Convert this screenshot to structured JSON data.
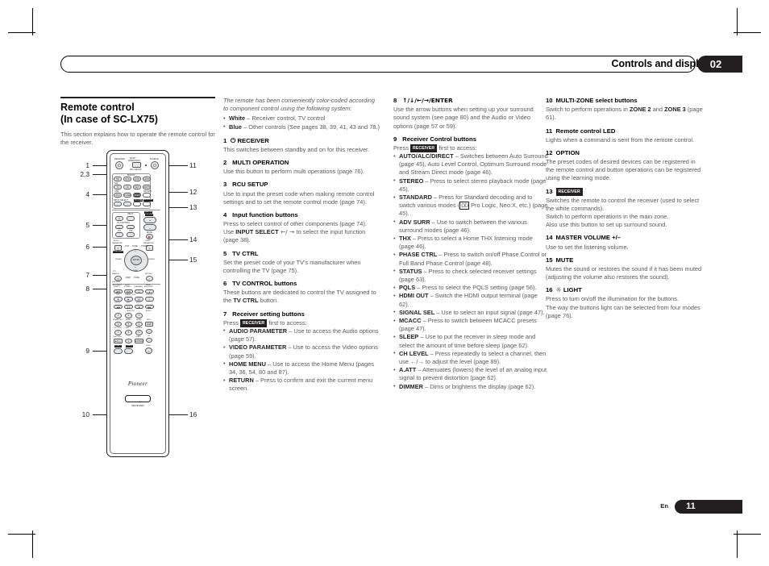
{
  "header": {
    "title": "Controls and displays",
    "chapter_number": "02"
  },
  "footer": {
    "language": "En",
    "page_number": "11"
  },
  "column1": {
    "section_title_line1": "Remote control",
    "section_title_line2": "(In case of SC-LX75)",
    "section_intro": "This section explains how to operate the remote control for the receiver.",
    "callouts": [
      "1",
      "2,3",
      "4",
      "5",
      "6",
      "7",
      "8",
      "9",
      "10",
      "11",
      "12",
      "13",
      "14",
      "15",
      "16"
    ],
    "remote": {
      "brand": "Pioneer",
      "model_chip": "RECEIVER",
      "top_labels": {
        "receiver": "RECEIVER",
        "multi_operation": "MULTI OPERATION",
        "source": "SOURCE",
        "rcu_setup": "RCU SETUP"
      },
      "input_rows": [
        {
          "group_left": "",
          "group_mid": "BD/DVD",
          "buttons": [
            "BD",
            "DVD",
            "DVR",
            "HDMI"
          ]
        },
        {
          "group_left": "SAT",
          "group_mid": "",
          "buttons": [
            "TV",
            "CD",
            "NET",
            "ADPT"
          ]
        },
        {
          "group_left": "USB",
          "group_mid": "",
          "buttons": [
            "iPod",
            "TUNER",
            "VIDEO"
          ]
        }
      ],
      "input_select": "INPUT SELECT",
      "tv_ctrl": "TV CTRL",
      "option": "OPTION",
      "receiver_btn": "RECEIVER",
      "tv_control": "TV CONTROL",
      "tv_input": "INPUT",
      "master_volume": "MASTER VOLUME",
      "mute": "MUTE",
      "ch": "CH",
      "vol": "VOL",
      "audio_parameter": "AUDIO PARAMETER",
      "video_parameter": "VIDEO PARAMETER",
      "home_menu": "HOME MENU",
      "list": "LIST",
      "tune": "TUNE",
      "tools": "TOOLS",
      "enter": "ENTER",
      "preset": "PRESET",
      "return": "RETURN",
      "pty_search": "PTY SEARCH",
      "disp": "DISP",
      "listening_rows": [
        [
          "AUTO/ALC/DIRECT",
          "STEREO",
          "STANDARD",
          "ADV SURR"
        ],
        [
          "THX",
          "PHASE CTRL",
          "STATUS"
        ],
        [
          "TV/DTV",
          "MPX",
          "PQLS"
        ]
      ],
      "numpad": [
        "1",
        "2",
        "3",
        "4",
        "5",
        "6",
        "7",
        "8",
        "9",
        "0"
      ],
      "numpad_labels": [
        "HDMI OUT",
        "SIGNAL SEL",
        "MCACC",
        "SLEEP",
        "CH LEVEL",
        "A.ATT",
        "DIMMER",
        "CLASS",
        "D.ACCESS"
      ],
      "side_labels": [
        "AUDIO",
        "INFO",
        "DISP",
        "CH"
      ],
      "zones": [
        "ZONE 2",
        "ZONE 3"
      ],
      "light": "LIGHT"
    }
  },
  "column2": {
    "intro_italic": "The remote has been conveniently color-coded according to component control using the following system:",
    "color_bullets": [
      {
        "bold": "White",
        "text": " – Receiver control, TV control"
      },
      {
        "bold": "Blue",
        "text": " – Other controls (See pages 38, 39, 41, 43 and 78.)"
      }
    ],
    "entries": [
      {
        "num": "1",
        "title": "RECEIVER",
        "title_prefix_icon": "power-icon",
        "body": "This switches between standby and on for this receiver."
      },
      {
        "num": "2",
        "title": "MULTI OPERATION",
        "body": "Use this button to perform multi operations (page 76)."
      },
      {
        "num": "3",
        "title": "RCU SETUP",
        "body": "Use to input the preset code when making remote control settings and to set the remote control mode (page 74)."
      },
      {
        "num": "4",
        "title": "Input function buttons",
        "body": "Press to select control of other components (page 74).",
        "body2_pre": "Use ",
        "body2_bold": "INPUT SELECT",
        "body2_arrows": " ←/ → ",
        "body2_post": "to select the input function (page 38)."
      },
      {
        "num": "5",
        "title": "TV CTRL",
        "body": "Set the preset code of your TV's manufacturer when controlling the TV (page 75)."
      },
      {
        "num": "6",
        "title": "TV CONTROL buttons",
        "body_pre": "These buttons are dedicated to control the TV assigned to the ",
        "body_bold": "TV CTRL",
        "body_post": " button."
      },
      {
        "num": "7",
        "title": "Receiver setting buttons",
        "body_pre": "Press ",
        "chip": "RECEIVER",
        "body_post": " first to access:",
        "bullets": [
          {
            "bold": "AUDIO PARAMETER",
            "text": " – Use to access the Audio options (page 57)."
          },
          {
            "bold": "VIDEO PARAMETER",
            "text": " – Use to access the Video options (page 59)."
          },
          {
            "bold": "HOME MENU",
            "text": " – Use to access the Home Menu (pages 34, 36, 54, 80 and 87)."
          },
          {
            "bold": "RETURN",
            "text": " – Press to confirm and exit the current menu screen."
          }
        ]
      }
    ]
  },
  "column3": {
    "entries": [
      {
        "num": "8",
        "title": "↑/↓/←/→/ENTER",
        "body": "Use the arrow buttons when setting up your surround sound system (see page 80) and the Audio or Video options (page 57 or 59)."
      },
      {
        "num": "9",
        "title": "Receiver Control buttons",
        "body_pre": "Press ",
        "chip": "RECEIVER",
        "body_post": " first to access:",
        "bullets": [
          {
            "bold": "AUTO/ALC/DIRECT",
            "text": " – Switches between Auto Surround (page 45), Auto Level Control, Optimum Surround mode and Stream Direct mode (page 46)."
          },
          {
            "bold": "STEREO",
            "text": " – Press to select stereo playback mode (page 45)."
          },
          {
            "bold": "STANDARD",
            "text": " – Press for Standard decoding and to switch various modes (",
            "dd": "DD",
            "text2": " Pro Logic, Neo:X, etc.) (page 45)."
          },
          {
            "bold": "ADV SURR",
            "text": " – Use to switch between the various surround modes (page 46)."
          },
          {
            "bold": "THX",
            "text": " – Press to select a Home THX listening mode (page 46)."
          },
          {
            "bold": "PHASE CTRL",
            "text": " – Press to switch on/off Phase Control or Full Band Phase Control (page 48)."
          },
          {
            "bold": "STATUS",
            "text": " – Press to check selected receiver settings (page 63)."
          },
          {
            "bold": "PQLS",
            "text": " – Press to select the PQLS setting (page 56)."
          },
          {
            "bold": "HDMI OUT",
            "text": " – Switch the HDMI output terminal (page 62)."
          },
          {
            "bold": "SIGNAL SEL",
            "text": " – Use to select an input signal (page 47)."
          },
          {
            "bold": "MCACC",
            "text": " – Press to switch between MCACC presets (page 47)."
          },
          {
            "bold": "SLEEP",
            "text": " – Use to put the receiver in sleep mode and select the amount of time before sleep (page 62)."
          },
          {
            "bold": "CH LEVEL",
            "text": " – Press repeatedly to select a channel, then use ←/→ to adjust the level (page 89)."
          },
          {
            "bold": "A.ATT",
            "text": " – Attenuates (lowers) the level of an analog input signal to prevent distortion (page 62)."
          },
          {
            "bold": "DIMMER",
            "text": " – Dims or brightens the display (page 62)."
          }
        ]
      }
    ]
  },
  "column4": {
    "entries": [
      {
        "num": "10",
        "title": "MULTI-ZONE select buttons",
        "body_pre": "Switch to perform operations in ",
        "body_bold1": "ZONE 2",
        "body_mid": " and ",
        "body_bold2": "ZONE 3",
        "body_post": " (page 61)."
      },
      {
        "num": "11",
        "title": "Remote control LED",
        "body": "Lights when a command is sent from the remote control."
      },
      {
        "num": "12",
        "title": "OPTION",
        "body": "The preset codes of desired devices can be registered in the remote control and button operations can be registered using the learning mode."
      },
      {
        "num": "13",
        "title": "",
        "chip": "RECEIVER",
        "body": "Switches the remote to control the receiver (used to select the white commands).\nSwitch to perform operations in the main zone.\nAlso use this button to set up surround sound."
      },
      {
        "num": "14",
        "title": "MASTER VOLUME +/–",
        "body": "Use to set the listening volume."
      },
      {
        "num": "15",
        "title": "MUTE",
        "body": "Mutes the sound or restores the sound if it has been muted (adjusting the volume also restores the sound)."
      },
      {
        "num": "16",
        "title": "LIGHT",
        "title_prefix_icon": "light-bulb-icon",
        "body": "Press to turn on/off the illumination for the buttons.\nThe way the buttons light can be selected from four modes (page 76)."
      }
    ]
  }
}
